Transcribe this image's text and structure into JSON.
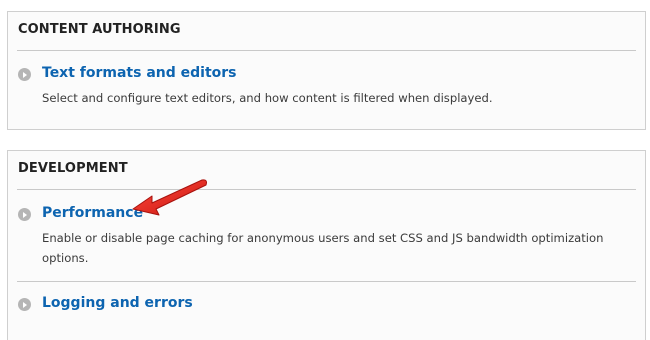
{
  "sections": [
    {
      "title": "CONTENT AUTHORING",
      "items": [
        {
          "label": "Text formats and editors",
          "description": "Select and configure text editors, and how content is filtered when displayed."
        }
      ]
    },
    {
      "title": "DEVELOPMENT",
      "items": [
        {
          "label": "Performance",
          "description": "Enable or disable page caching for anonymous users and set CSS and JS bandwidth optimization options."
        },
        {
          "label": "Logging and errors",
          "description": ""
        }
      ]
    }
  ],
  "colors": {
    "link": "#0d64b0",
    "annotation_arrow": "#e0201e"
  },
  "icons": {
    "item_bullet": "chevron-right-circle-icon",
    "annotation": "red-arrow-icon"
  }
}
